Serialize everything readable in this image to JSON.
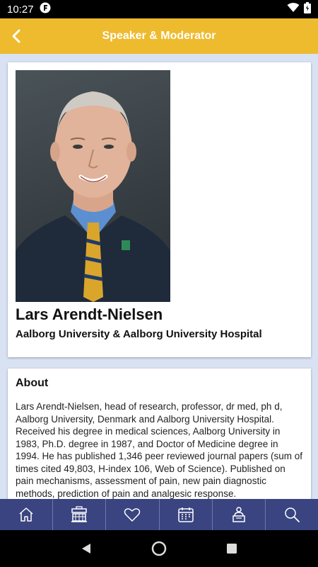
{
  "status_bar": {
    "time": "10:27"
  },
  "app_bar": {
    "title": "Speaker & Moderator"
  },
  "speaker": {
    "name": "Lars Arendt-Nielsen",
    "affiliation": "Aalborg University & Aalborg University Hospital"
  },
  "about": {
    "title": "About",
    "text": "Lars Arendt-Nielsen, head of research, professor, dr med, ph d, Aalborg University, Denmark and Aalborg University Hospital. Received his degree in medical sciences, Aalborg University in 1983, Ph.D. degree in 1987, and Doctor of Medicine degree in 1994. He has published 1,346 peer reviewed journal papers (sum of times cited 49,803, H-index 106, Web of Science). Published on pain mechanisms, assessment of pain, new pain diagnostic methods, prediction of pain and analgesic response."
  },
  "bottom_nav": {
    "items": [
      {
        "icon": "home-icon"
      },
      {
        "icon": "exhibition-booth-icon"
      },
      {
        "icon": "heart-icon"
      },
      {
        "icon": "calendar-icon"
      },
      {
        "icon": "speaker-podium-icon"
      },
      {
        "icon": "search-icon"
      }
    ]
  },
  "colors": {
    "app_bar": "#EEBA2E",
    "content_bg": "#D9E2F2",
    "bottom_nav": "#3A4480"
  }
}
